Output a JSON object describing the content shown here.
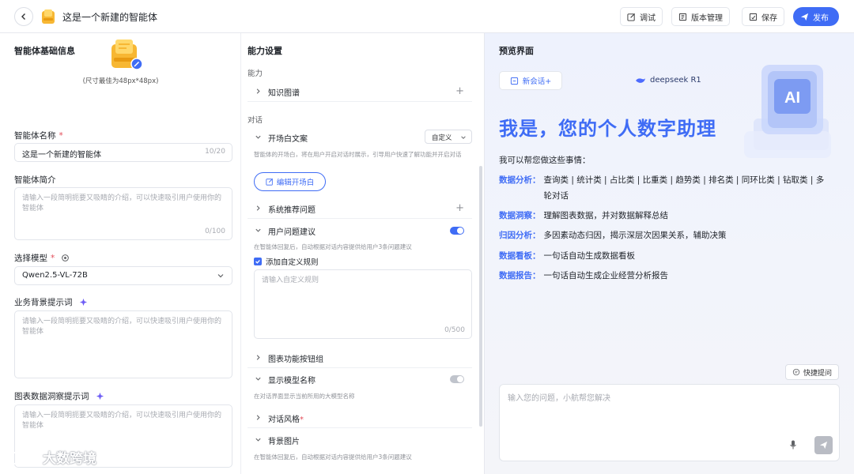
{
  "header": {
    "title": "这是一个新建的智能体",
    "buttons": {
      "debug": "调试",
      "version": "版本管理",
      "save": "保存",
      "publish": "发布"
    }
  },
  "left": {
    "section_title": "智能体基础信息",
    "avatar_hint": "(尺寸最佳为48px*48px)",
    "name_label": "智能体名称",
    "name_value": "这是一个新建的智能体",
    "name_count": "10/20",
    "intro_label": "智能体简介",
    "intro_placeholder": "请输入一段简明扼要又吸睛的介绍，可以快速吸引用户使用你的智能体",
    "intro_count": "0/100",
    "model_label": "选择模型",
    "model_value": "Qwen2.5-VL-72B",
    "bg_prompt_label": "业务背景提示词",
    "bg_prompt_placeholder": "请输入一段简明扼要又吸睛的介绍，可以快速吸引用户使用你的智能体",
    "insight_prompt_label": "图表数据洞察提示词",
    "insight_prompt_placeholder": "请输入一段简明扼要又吸睛的介绍，可以快速吸引用户使用你的智能体"
  },
  "middle": {
    "section_title": "能力设置",
    "group_ability": "能力",
    "knowledge_graph": "知识图谱",
    "group_dialog": "对话",
    "opening_text": "开场白文案",
    "opening_mode": "自定义",
    "opening_desc": "智能体的开场白，将在用户开启对话时展示，引导用户快速了解功能并开启对话",
    "edit_opening": "编辑开场白",
    "recommended_questions": "系统推荐问题",
    "user_suggestions": "用户问题建议",
    "user_suggestions_desc": "在智能体回复后，自动根据对话内容提供给用户3条问题建议",
    "custom_rule_label": "添加自定义规则",
    "custom_rule_placeholder": "请输入自定义规则",
    "custom_rule_count": "0/500",
    "chart_buttons": "图表功能按钮组",
    "show_model_name": "显示模型名称",
    "show_model_desc": "在对话界面显示当前所用的大模型名称",
    "dialog_style": "对话风格",
    "bg_image": "背景图片",
    "bg_image_desc": "在智能体回复后，自动根据对话内容提供给用户3条问题建议"
  },
  "right": {
    "section_title": "预览界面",
    "new_chat": "新会话+",
    "model_tag": "deepseek  R1",
    "hero_title": "我是，您的个人数字助理",
    "intro": "我可以帮您做这些事情：",
    "features": [
      {
        "key": "数据分析：",
        "value": "查询类 | 统计类 | 占比类 | 比重类 | 趋势类 | 排名类 | 同环比类 | 钻取类 | 多轮对话"
      },
      {
        "key": "数据洞察：",
        "value": "理解图表数据，并对数据解释总结"
      },
      {
        "key": "归因分析：",
        "value": "多因素动态归因，揭示深层次因果关系，辅助决策"
      },
      {
        "key": "数据看板：",
        "value": "一句话自动生成数据看板"
      },
      {
        "key": "数据报告：",
        "value": "一句话自动生成企业经营分析报告"
      }
    ],
    "ai_badge": "AI",
    "quick_ask": "快捷提问",
    "chat_placeholder": "输入您的问题，小航帮您解决"
  },
  "watermark": "大数跨境",
  "colors": {
    "accent": "#3f6cf5",
    "background": "#eef1f7"
  }
}
